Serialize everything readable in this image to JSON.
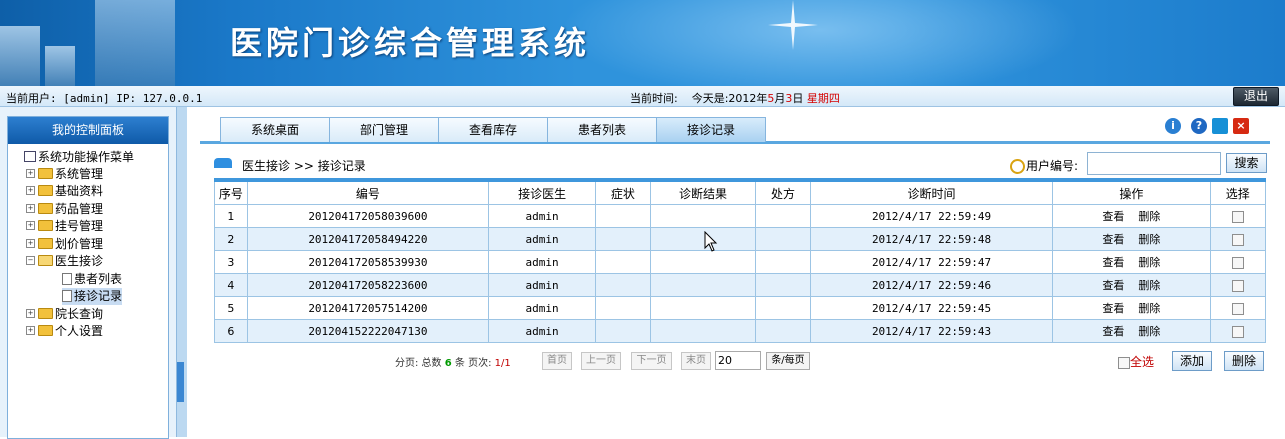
{
  "header": {
    "title": "医院门诊综合管理系统"
  },
  "infobar": {
    "user_label": "当前用户: [admin] IP: 127.0.0.1",
    "time_label": "当前时间:",
    "date_prefix": "今天是:2012年",
    "month": "5",
    "month_unit": "月",
    "day": "3",
    "day_unit": "日",
    "weekday": "星期四",
    "logout": "退出"
  },
  "sidebar": {
    "panel_title": "我的控制面板",
    "root": "系统功能操作菜单",
    "items": [
      {
        "label": "系统管理"
      },
      {
        "label": "基础资料"
      },
      {
        "label": "药品管理"
      },
      {
        "label": "挂号管理"
      },
      {
        "label": "划价管理"
      },
      {
        "label": "医生接诊",
        "children": [
          {
            "label": "患者列表"
          },
          {
            "label": "接诊记录"
          }
        ]
      },
      {
        "label": "院长查询"
      },
      {
        "label": "个人设置"
      }
    ]
  },
  "tabs": [
    {
      "label": "系统桌面"
    },
    {
      "label": "部门管理"
    },
    {
      "label": "查看库存"
    },
    {
      "label": "患者列表"
    },
    {
      "label": "接诊记录"
    }
  ],
  "breadcrumb": {
    "section": "医生接诊",
    "sep": ">>",
    "page": "接诊记录"
  },
  "search": {
    "label": "用户编号:",
    "value": "",
    "button": "搜索"
  },
  "table": {
    "headers": [
      "序号",
      "编号",
      "接诊医生",
      "症状",
      "诊断结果",
      "处方",
      "诊断时间",
      "操作",
      "选择"
    ],
    "view_label": "查看",
    "delete_label": "删除",
    "rows": [
      {
        "idx": "1",
        "code": "201204172058039600",
        "doctor": "admin",
        "symptom": "",
        "diagnosis": "",
        "prescription": "",
        "time": "2012/4/17 22:59:49"
      },
      {
        "idx": "2",
        "code": "201204172058494220",
        "doctor": "admin",
        "symptom": "",
        "diagnosis": "",
        "prescription": "",
        "time": "2012/4/17 22:59:48"
      },
      {
        "idx": "3",
        "code": "201204172058539930",
        "doctor": "admin",
        "symptom": "",
        "diagnosis": "",
        "prescription": "",
        "time": "2012/4/17 22:59:47"
      },
      {
        "idx": "4",
        "code": "201204172058223600",
        "doctor": "admin",
        "symptom": "",
        "diagnosis": "",
        "prescription": "",
        "time": "2012/4/17 22:59:46"
      },
      {
        "idx": "5",
        "code": "201204172057514200",
        "doctor": "admin",
        "symptom": "",
        "diagnosis": "",
        "prescription": "",
        "time": "2012/4/17 22:59:45"
      },
      {
        "idx": "6",
        "code": "201204152222047130",
        "doctor": "admin",
        "symptom": "",
        "diagnosis": "",
        "prescription": "",
        "time": "2012/4/17 22:59:43"
      }
    ]
  },
  "pager": {
    "prefix": "分页: 总数",
    "total": "6",
    "mid": "条 页次:",
    "page": "1/1",
    "first": "首页",
    "prev": "上一页",
    "next": "下一页",
    "last": "末页",
    "page_size": "20",
    "per_page": "条/每页"
  },
  "actions": {
    "select_all": "全选",
    "add": "添加",
    "delete": "删除"
  },
  "colors": {
    "accent": "#3f97dc",
    "alt_row": "#e3f0fb",
    "highlight": "#d40000"
  }
}
